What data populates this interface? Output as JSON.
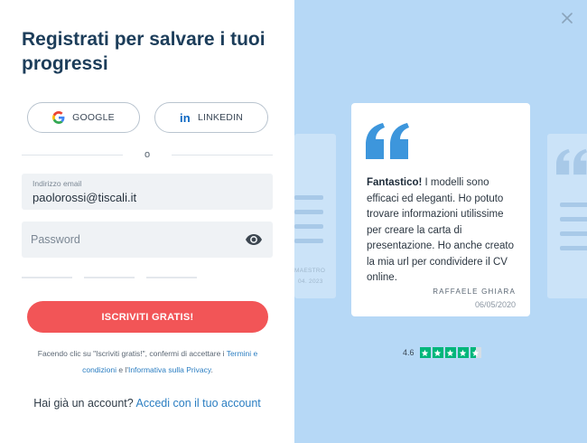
{
  "signup": {
    "title": "Registrati per salvare i tuoi progressi",
    "google_label": "GOOGLE",
    "linkedin_label": "LINKEDIN",
    "linkedin_icon": "in",
    "or_label": "o",
    "email": {
      "label": "Indirizzo email",
      "value": "paolorossi@tiscali.it"
    },
    "password": {
      "placeholder": "Password"
    },
    "cta_label": "ISCRIVITI GRATIS!",
    "terms": {
      "prefix": "Facendo clic su \"Iscriviti gratis!\", confermi di accettare i ",
      "link1": "Termini e condizioni",
      "middle": " e l'",
      "link2": "Informativa sulla Privacy",
      "suffix": "."
    },
    "login": {
      "prompt": "Hai già un account? ",
      "link": "Accedi con il tuo account"
    }
  },
  "testimonial": {
    "bold": "Fantastico!",
    "text": " I modelli sono efficaci ed eleganti. Ho potuto trovare informazioni utilissime per creare la carta di presentazione. Ho anche creato la mia url per condividere il CV online.",
    "author": "RAFFAELE GHIARA",
    "date": "06/05/2020",
    "ghost_author": "MAESTRO",
    "ghost_date": "04. 2023"
  },
  "rating": {
    "score": "4.6",
    "stars": 4.5,
    "max": 5
  },
  "colors": {
    "title": "#1c3d5a",
    "cta": "#f25557",
    "link": "#2b7ec2",
    "right_bg": "#b6d8f6",
    "quote": "#3d96dc",
    "star": "#00b67a"
  }
}
